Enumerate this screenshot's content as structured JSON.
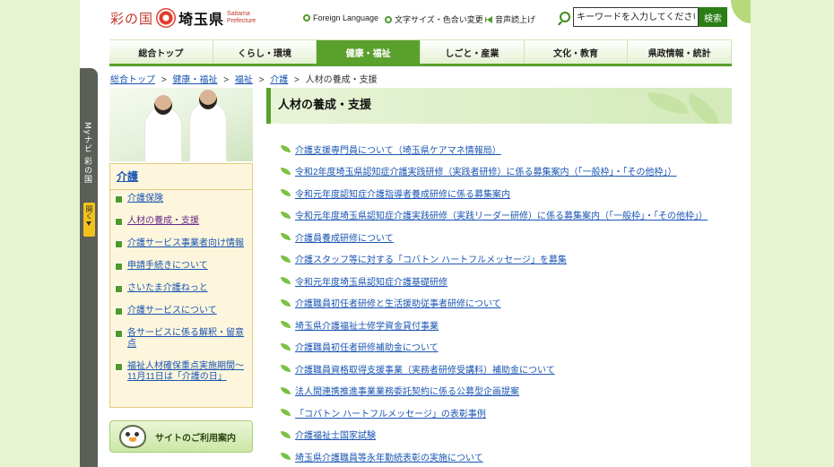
{
  "header": {
    "logo_kuni": "彩の国",
    "logo_name": "埼玉県",
    "logo_en": "Saitama Prefecture",
    "util_links": [
      "Foreign Language",
      "文字サイズ・色合い変更",
      "音声読上げ"
    ],
    "search_placeholder": "キーワードを入力してください",
    "search_button": "検索"
  },
  "nav": {
    "items": [
      "総合トップ",
      "くらし・環境",
      "健康・福祉",
      "しごと・産業",
      "文化・教育",
      "県政情報・統計"
    ],
    "active_index": 2
  },
  "breadcrumb": {
    "links": [
      "総合トップ",
      "健康・福祉",
      "福祉",
      "介護"
    ],
    "separator": ">",
    "current": "人材の養成・支援"
  },
  "side_tab": {
    "label": "Myナビ 彩の国",
    "open_label": "開く"
  },
  "sidebar": {
    "title": "介護",
    "items": [
      "介護保険",
      "人材の養成・支援",
      "介護サービス事業者向け情報",
      "申請手続きについて",
      "さいたま介護ねっと",
      "介護サービスについて",
      "各サービスに係る解釈・留意点",
      "福祉人材確保重点実施期間～11月11日は「介護の日」"
    ],
    "current_index": 1,
    "guide_label": "サイトのご利用案内"
  },
  "main": {
    "title": "人材の養成・支援",
    "links": [
      "介護支援専門員について（埼玉県ケアマネ情報局）",
      "令和2年度埼玉県認知症介護実践研修（実践者研修）に係る募集案内（「一般枠」・「その他枠」）",
      "令和元年度認知症介護指導者養成研修に係る募集案内",
      "令和元年度埼玉県認知症介護実践研修（実践リーダー研修）に係る募集案内（「一般枠」・「その他枠」）",
      "介護員養成研修について",
      "介護スタッフ等に対する「コバトン ハートフルメッセージ」を募集",
      "令和元年度埼玉県認知症介護基礎研修",
      "介護職員初任者研修と生活援助従事者研修について",
      "埼玉県介護福祉士修学資金貸付事業",
      "介護職員初任者研修補助金について",
      "介護職員資格取得支援事業（実務者研修受講料）補助金について",
      "法人間連携推進事業業務委託契約に係る公募型企画提案",
      "「コバトン ハートフルメッセージ」の表彰事例",
      "介護福祉士国家試験",
      "埼玉県介護職員等永年勤続表彰の実施について"
    ]
  },
  "colors": {
    "accent_green": "#5aa02c",
    "link_blue": "#1a55b3",
    "visited_purple": "#6b2a8a",
    "side_tab_gray": "#5a5f57",
    "open_yellow": "#f2c21a"
  }
}
